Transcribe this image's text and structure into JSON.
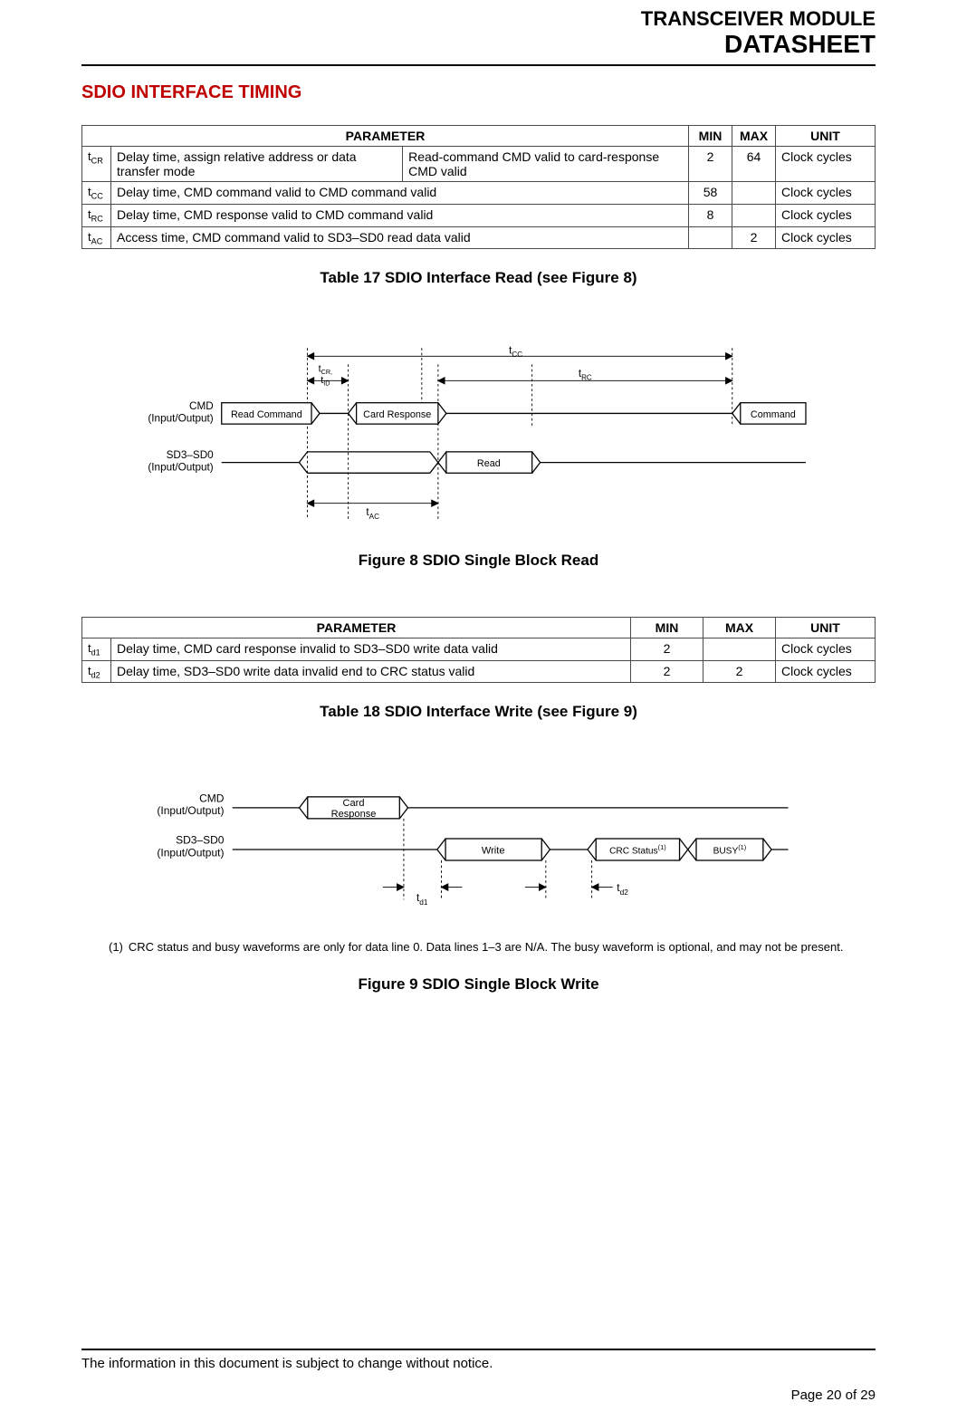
{
  "header": {
    "line1": "TRANSCEIVER MODULE",
    "line2": "DATASHEET"
  },
  "section_title": "SDIO INTERFACE TIMING",
  "table17": {
    "headers": {
      "param": "PARAMETER",
      "min": "MIN",
      "max": "MAX",
      "unit": "UNIT"
    },
    "rows": [
      {
        "sym": "t",
        "sub": "CR",
        "desc": "Delay time, assign relative address or data transfer mode",
        "desc2": "Read-command CMD valid to card-response CMD valid",
        "min": "2",
        "max": "64",
        "unit": "Clock cycles"
      },
      {
        "sym": "t",
        "sub": "CC",
        "desc": "Delay time, CMD command valid to CMD command valid",
        "desc2": "",
        "min": "58",
        "max": "",
        "unit": "Clock cycles"
      },
      {
        "sym": "t",
        "sub": "RC",
        "desc": "Delay time, CMD response valid to CMD command valid",
        "desc2": "",
        "min": "8",
        "max": "",
        "unit": "Clock cycles"
      },
      {
        "sym": "t",
        "sub": "AC",
        "desc": "Access time, CMD command valid to SD3–SD0 read data valid",
        "desc2": "",
        "min": "",
        "max": "2",
        "unit": "Clock cycles"
      }
    ],
    "caption": "Table 17 SDIO Interface Read (see Figure 8)"
  },
  "figure8": {
    "caption": "Figure 8 SDIO Single Block Read",
    "labels": {
      "cmd": "CMD",
      "cmd_io": "(Input/Output)",
      "sd": "SD3–SD0",
      "sd_io": "(Input/Output)",
      "read_cmd": "Read Command",
      "card_resp": "Card Response",
      "command": "Command",
      "read": "Read",
      "tcc": "t",
      "tcc_sub": "CC",
      "trc": "t",
      "trc_sub": "RC",
      "tcrid": "t",
      "tcrid_sub1": "CR,",
      "tid_sub": "ID",
      "tac": "t",
      "tac_sub": "AC"
    }
  },
  "table18": {
    "headers": {
      "param": "PARAMETER",
      "min": "MIN",
      "max": "MAX",
      "unit": "UNIT"
    },
    "rows": [
      {
        "sym": "t",
        "sub": "d1",
        "desc": "Delay time, CMD card response invalid to SD3–SD0 write data valid",
        "min": "2",
        "max": "",
        "unit": "Clock cycles"
      },
      {
        "sym": "t",
        "sub": "d2",
        "desc": "Delay time, SD3–SD0 write data invalid end to CRC status valid",
        "min": "2",
        "max": "2",
        "unit": "Clock cycles"
      }
    ],
    "caption": "Table 18 SDIO Interface Write (see Figure 9)"
  },
  "figure9": {
    "caption": "Figure 9 SDIO Single Block Write",
    "labels": {
      "cmd": "CMD",
      "cmd_io": "(Input/Output)",
      "sd": "SD3–SD0",
      "sd_io": "(Input/Output)",
      "card_resp": "Card",
      "card_resp2": "Response",
      "write": "Write",
      "crc": "CRC Status",
      "busy": "BUSY",
      "sup": "(1)",
      "td1": "t",
      "td1_sub": "d1",
      "td2": "t",
      "td2_sub": "d2"
    },
    "footnote_num": "(1)",
    "footnote": "CRC status and busy waveforms are only for data line 0. Data lines 1–3 are N/A. The busy waveform is optional, and may not be present."
  },
  "footer": {
    "note": "The information in this document is subject to change without notice.",
    "page": "Page 20 of 29"
  }
}
